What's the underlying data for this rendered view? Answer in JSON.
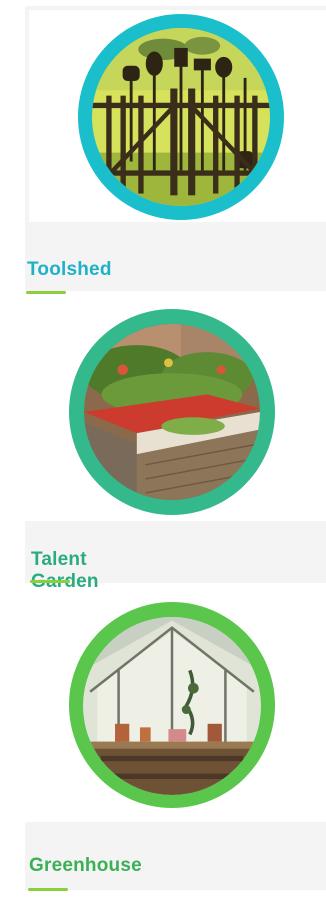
{
  "cards": [
    {
      "title": "Toolshed",
      "image_icon": "garden-tools-fence-photo",
      "ring_color": "#1bbfcb",
      "title_color": "#1fb2c6",
      "underline_color": "#8ccf3c"
    },
    {
      "title": "Talent Garden",
      "image_icon": "raised-garden-beds-photo",
      "ring_color": "#33b98c",
      "title_color": "#2aac7f",
      "underline_color": "#8ccf3c"
    },
    {
      "title": "Greenhouse",
      "image_icon": "greenhouse-interior-photo",
      "ring_color": "#5ac64b",
      "title_color": "#3caf57",
      "underline_color": "#8ccf3c"
    }
  ]
}
